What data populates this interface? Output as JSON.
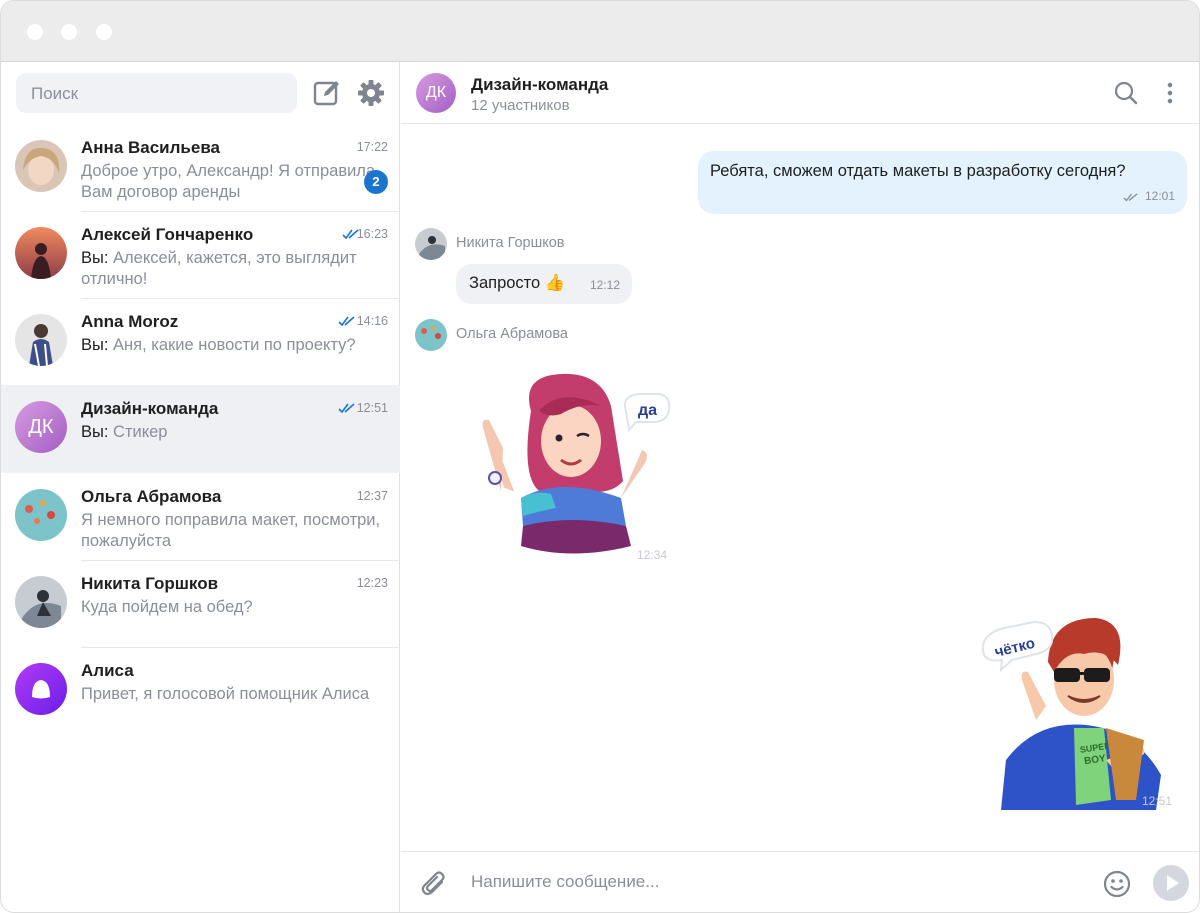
{
  "sidebar": {
    "search_placeholder": "Поиск",
    "chats": [
      {
        "name": "Анна Васильева",
        "preview": "Доброе утро, Александр! Я отправила Вам договор аренды",
        "time": "17:22",
        "unread": "2"
      },
      {
        "name": "Алексей Гончаренко",
        "you": "Вы:",
        "preview": " Алексей, кажется, это выглядит отлично!",
        "time": "16:23"
      },
      {
        "name": "Anna Moroz",
        "you": "Вы:",
        "preview": " Аня, какие новости по проекту?",
        "time": "14:16"
      },
      {
        "name": "Дизайн-команда",
        "you": "Вы:",
        "preview": " Стикер",
        "time": "12:51",
        "initials": "ДК"
      },
      {
        "name": "Ольга Абрамова",
        "preview": "Я немного поправила макет, посмотри, пожалуйста",
        "time": "12:37"
      },
      {
        "name": "Никита Горшков",
        "preview": "Куда пойдем на обед?",
        "time": "12:23"
      },
      {
        "name": "Алиса",
        "preview": "Привет, я голосовой помощник Алиса"
      }
    ]
  },
  "chat": {
    "title": "Дизайн-команда",
    "subtitle": "12 участников",
    "initials": "ДК",
    "messages": {
      "outgoing": {
        "text": "Ребята, сможем отдать макеты в разработку сегодня?",
        "time": "12:01"
      },
      "nikita": {
        "sender": "Никита Горшков",
        "text": "Запросто 👍",
        "time": "12:12"
      },
      "olga": {
        "sender": "Ольга Абрамова",
        "sticker_text": "да",
        "time": "12:34"
      },
      "mine_sticker": {
        "sticker_text": "чётко",
        "shirt_text_1": "SUPER",
        "shirt_text_2": "BOY",
        "time": "12:51"
      }
    },
    "composer_placeholder": "Напишите сообщение..."
  },
  "colors": {
    "accent": "#1b75d0",
    "outgoing_bubble": "#e3f2fd",
    "incoming_bubble": "#f0f1f4",
    "active_chat": "#eef0f3"
  }
}
